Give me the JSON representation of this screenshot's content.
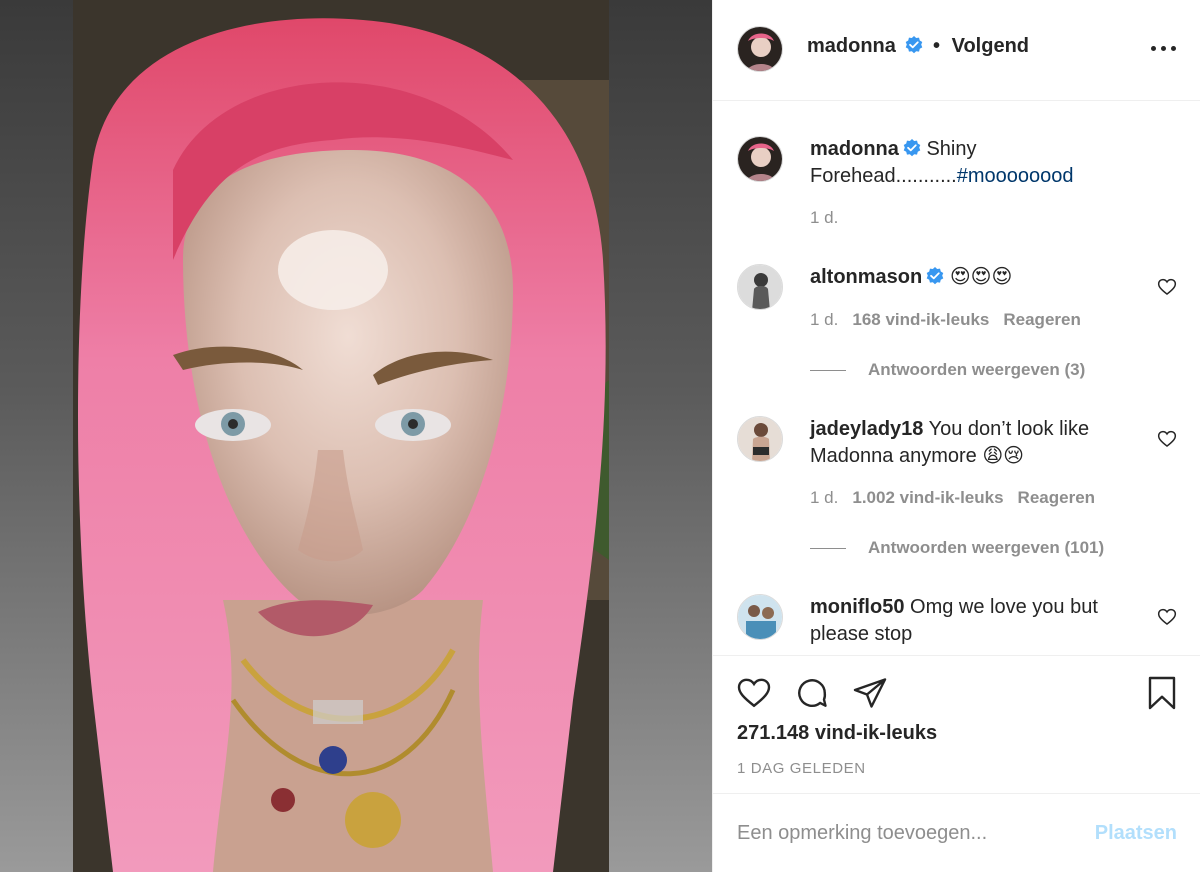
{
  "post": {
    "author": "madonna",
    "follow_label": "Volgend",
    "separator": "•",
    "caption_text": "Shiny Forehead...........",
    "caption_hashtag": "#moooooood",
    "caption_age": "1 d.",
    "likes_label": "271.148 vind-ik-leuks",
    "date_label": "1 DAG GELEDEN"
  },
  "comments": [
    {
      "user": "altonmason",
      "verified": true,
      "text": "😍😍😍",
      "age": "1 d.",
      "likes": "168 vind-ik-leuks",
      "reply_label": "Reageren",
      "view_replies": "Antwoorden weergeven (3)"
    },
    {
      "user": "jadeylady18",
      "verified": false,
      "text": "You don’t look like Madonna anymore 😩😢",
      "age": "1 d.",
      "likes": "1.002 vind-ik-leuks",
      "reply_label": "Reageren",
      "view_replies": "Antwoorden weergeven (101)"
    },
    {
      "user": "moniflo50",
      "verified": false,
      "text": "Omg we love you but please stop"
    }
  ],
  "composer": {
    "placeholder": "Een opmerking toevoegen...",
    "post_label": "Plaatsen"
  },
  "colors": {
    "verified_blue": "#3897f0",
    "hashtag": "#00376b",
    "muted": "#8e8e8e",
    "post_disabled": "#b2dffc"
  },
  "icons": [
    "more-options-icon",
    "verified-badge-icon",
    "heart-icon",
    "comment-icon",
    "share-icon",
    "bookmark-icon"
  ]
}
